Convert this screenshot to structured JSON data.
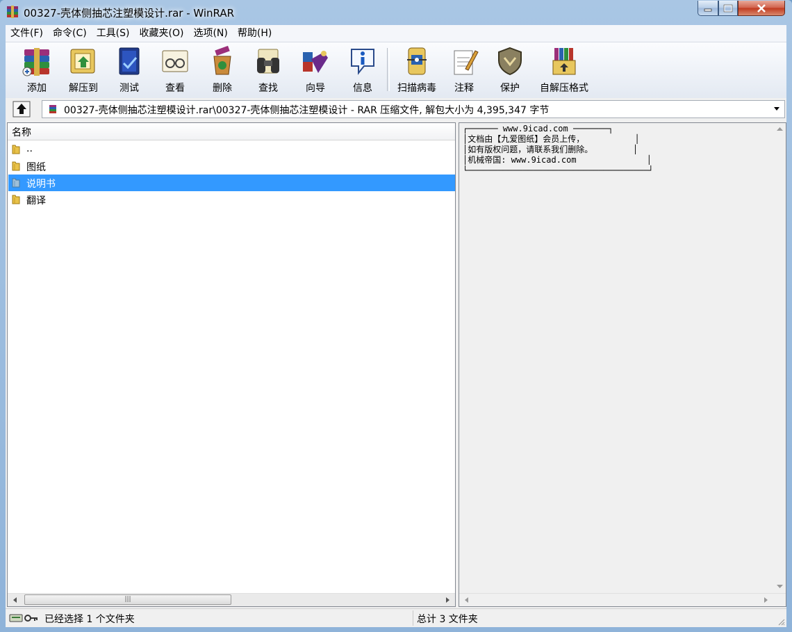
{
  "window": {
    "title": "00327-壳体侧抽芯注塑模设计.rar - WinRAR",
    "icon": "winrar-books-icon"
  },
  "menu": [
    "文件(F)",
    "命令(C)",
    "工具(S)",
    "收藏夹(O)",
    "选项(N)",
    "帮助(H)"
  ],
  "toolbar": [
    {
      "label": "添加",
      "icon": "add-archive-icon"
    },
    {
      "label": "解压到",
      "icon": "extract-to-icon"
    },
    {
      "label": "测试",
      "icon": "test-archive-icon"
    },
    {
      "label": "查看",
      "icon": "view-glasses-icon"
    },
    {
      "label": "删除",
      "icon": "delete-recycle-icon"
    },
    {
      "label": "查找",
      "icon": "find-binoculars-icon"
    },
    {
      "label": "向导",
      "icon": "wizard-icon"
    },
    {
      "label": "信息",
      "icon": "info-icon"
    },
    {
      "label": "扫描病毒",
      "icon": "virus-scan-icon"
    },
    {
      "label": "注释",
      "icon": "comment-pen-icon"
    },
    {
      "label": "保护",
      "icon": "protect-shield-icon"
    },
    {
      "label": "自解压格式",
      "icon": "sfx-box-icon"
    }
  ],
  "address": {
    "path": "00327-壳体侧抽芯注塑模设计.rar\\00327-壳体侧抽芯注塑模设计 - RAR 压缩文件, 解包大小为 4,395,347 字节"
  },
  "file_list": {
    "column_name": "名称",
    "items": [
      {
        "name": "..",
        "selected": false
      },
      {
        "name": "图纸",
        "selected": false
      },
      {
        "name": "说明书",
        "selected": true
      },
      {
        "name": "翻译",
        "selected": false
      }
    ]
  },
  "comment": {
    "lines": [
      "┌────── www.9icad.com ───────┐",
      "│文档由【九爱图纸】会员上传，          │",
      "│如有版权问题，请联系我们删除。        │",
      "│机械帝国: www.9icad.com              │",
      "└────────────────────────────────────┘"
    ]
  },
  "status": {
    "left": "已经选择 1 个文件夹",
    "right": "总计 3 文件夹"
  }
}
